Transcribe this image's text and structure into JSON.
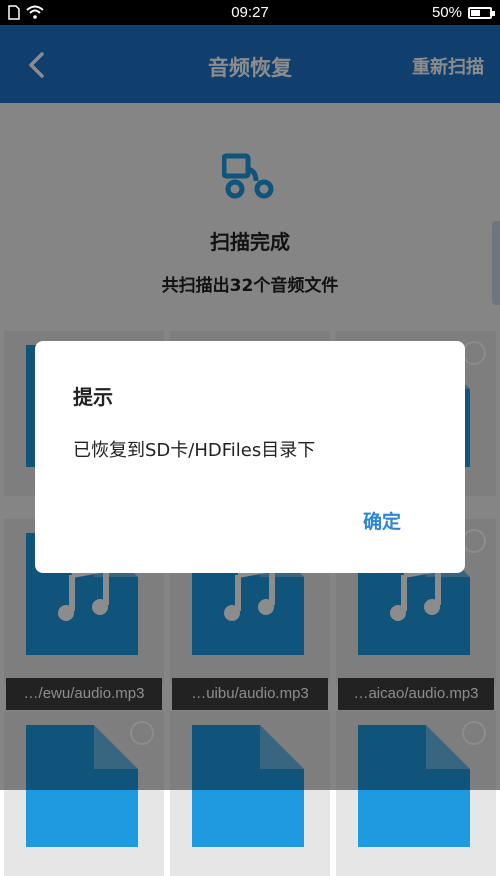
{
  "status_bar": {
    "time": "09:27",
    "battery": "50%",
    "battery_level": 0.5
  },
  "app_bar": {
    "title": "音频恢复",
    "action": "重新扫描"
  },
  "scan": {
    "status": "扫描完成",
    "summary": "共扫描出32个音频文件"
  },
  "files": [
    {
      "caption": "…/ewu/audio.mp3"
    },
    {
      "caption": "…uibu/audio.mp3"
    },
    {
      "caption": "…aicao/audio.mp3"
    }
  ],
  "dialog": {
    "title": "提示",
    "message": "已恢复到SD卡/HDFiles目录下",
    "ok": "确定"
  },
  "colors": {
    "primary": "#1e74c8",
    "accent": "#1e9ae0",
    "dialog_button": "#2b86d6"
  }
}
